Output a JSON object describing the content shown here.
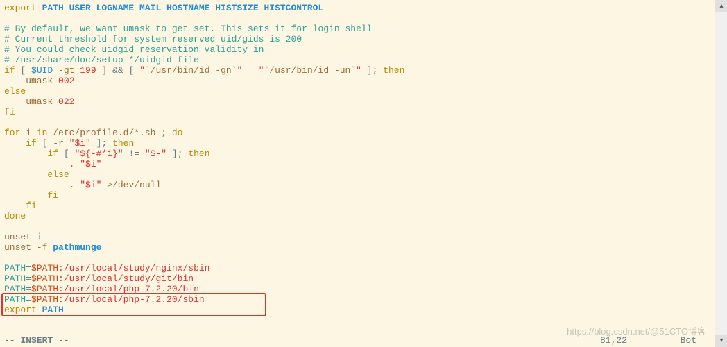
{
  "code": {
    "l1_export": "export",
    "l1_vars": " PATH USER LOGNAME MAIL HOSTNAME HISTSIZE HISTCONTROL",
    "c1": "# By default, we want umask to get set. This sets it for login shell",
    "c2": "# Current threshold for system reserved uid/gids is 200",
    "c3": "# You could check uidgid reservation validity in",
    "c4": "# /usr/share/doc/setup-*/uidgid file",
    "if": "if",
    "lb": " [ ",
    "uid": "$UID",
    "gt": " -gt ",
    "n199": "199",
    "rb_and_lb": " ] && [ ",
    "q1": "\"`",
    "cmd_gn": "/usr/bin/id -gn",
    "q2": "`\"",
    "eq": " = ",
    "q3": "\"`",
    "cmd_un": "/usr/bin/id -un",
    "q4": "`\"",
    "rb_then": " ]; ",
    "then": "then",
    "umask1_cmd": "    umask ",
    "umask1_val": "002",
    "else": "else",
    "umask2_cmd": "    umask ",
    "umask2_val": "022",
    "fi": "fi",
    "for": "for",
    "for_i": " i ",
    "in": "in",
    "for_glob": " /etc/profile.d/*.sh ; ",
    "do": "do",
    "if2_pre": "    ",
    "if2": "if",
    "if2_lb": " [ ",
    "if2_flag": "-r ",
    "if2_var": "\"$i\"",
    "if2_rb": " ]; ",
    "then2": "then",
    "if3_pre": "        ",
    "if3": "if",
    "if3_lb": " [ ",
    "if3_v1": "\"${-#*i}\"",
    "if3_ne": " != ",
    "if3_v2": "\"$-\"",
    "if3_rb": " ]; ",
    "then3": "then",
    "dot1_pre": "            . ",
    "dot1_var": "\"$i\"",
    "else2_pre": "        ",
    "else2": "else",
    "dot2_pre": "            . ",
    "dot2_var": "\"$i\"",
    "dot2_redir": " >/dev/null",
    "fi2_pre": "        ",
    "fi2": "fi",
    "fi3_pre": "    ",
    "fi3": "fi",
    "done": "done",
    "unset1": "unset",
    "unset1_arg": " i",
    "unset2": "unset",
    "unset2_flag": " -f ",
    "unset2_arg": "pathmunge",
    "p1_lhs": "PATH",
    "p1_eq": "=",
    "p1_exp": "$PATH",
    "p1_path": ":/usr/local/study/nginx/sbin",
    "p2_lhs": "PATH",
    "p2_eq": "=",
    "p2_exp": "$PATH",
    "p2_path": ":/usr/local/study/git/bin",
    "p3_lhs": "PATH",
    "p3_eq": "=",
    "p3_exp": "$PATH",
    "p3_path": ":/usr/local/php-7.2.20/bin",
    "p4_lhs": "PATH",
    "p4_eq": "=",
    "p4_exp": "$PATH",
    "p4_path": ":/usr/local/php-7.2.20/sbin",
    "exp2": "export",
    "exp2_arg": " PATH"
  },
  "status": {
    "mode": "-- INSERT --",
    "pos": "81,22",
    "pct": "Bot"
  },
  "watermark": "https://blog.csdn.net/@51CTO博客"
}
